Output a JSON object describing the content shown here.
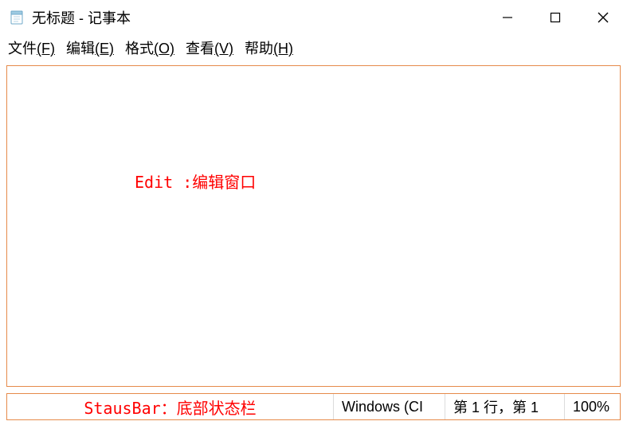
{
  "titlebar": {
    "title": "无标题 - 记事本"
  },
  "menubar": {
    "file": {
      "label": "文件",
      "accel": "(F)"
    },
    "edit": {
      "label": "编辑",
      "accel": "(E)"
    },
    "format": {
      "label": "格式",
      "accel": "(O)"
    },
    "view": {
      "label": "查看",
      "accel": "(V)"
    },
    "help": {
      "label": "帮助",
      "accel": "(H)"
    }
  },
  "annotations": {
    "edit_label": "Edit :编辑窗口",
    "statusbar_label": "StausBar：底部状态栏"
  },
  "statusbar": {
    "encoding": "Windows (CI",
    "line": "第 1 行，第 1",
    "zoom": "100%"
  }
}
